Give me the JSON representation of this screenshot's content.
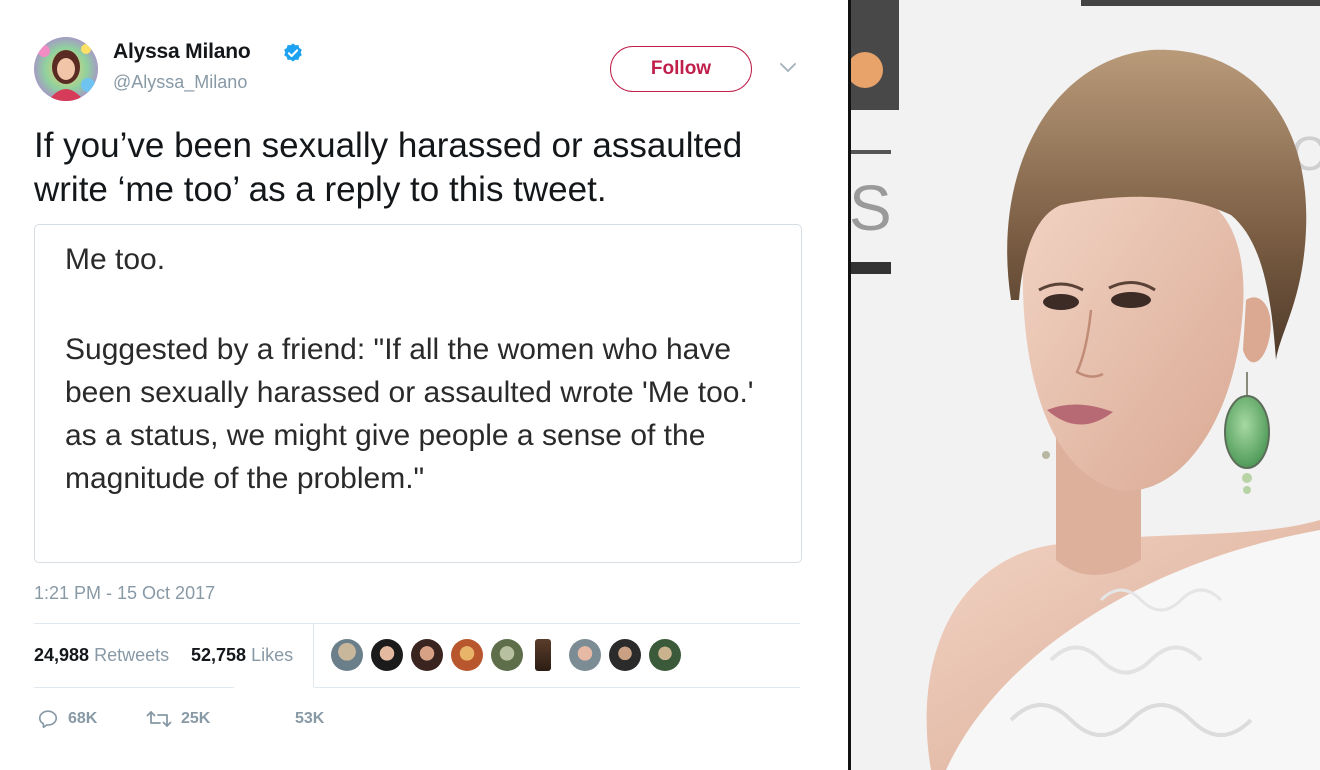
{
  "tweet": {
    "author_name": "Alyssa Milano",
    "handle": "@Alyssa_Milano",
    "follow_label": "Follow",
    "text_line1": "If you’ve been sexually harassed or assaulted",
    "text_line2": "write ‘me too’ as a reply to this tweet.",
    "card": {
      "line1": "Me too.",
      "body": "Suggested by a friend: \"If all the women who have been sexually harassed or assaulted wrote 'Me too.' as a status, we might give people a sense of the magnitude of the problem.\""
    },
    "timestamp": "1:21 PM - 15 Oct 2017",
    "retweets_count": "24,988",
    "retweets_label": "Retweets",
    "likes_count": "52,758",
    "likes_label": "Likes",
    "actions": {
      "reply_count": "68K",
      "retweet_count": "25K",
      "like_count": "53K"
    }
  },
  "colors": {
    "follow_accent": "#c01f4b",
    "verified_badge": "#1da1f2",
    "muted_text": "#8899a6"
  },
  "icons": [
    "verified-badge-icon",
    "chevron-down-icon",
    "reply-icon",
    "retweet-icon",
    "like-icon"
  ]
}
